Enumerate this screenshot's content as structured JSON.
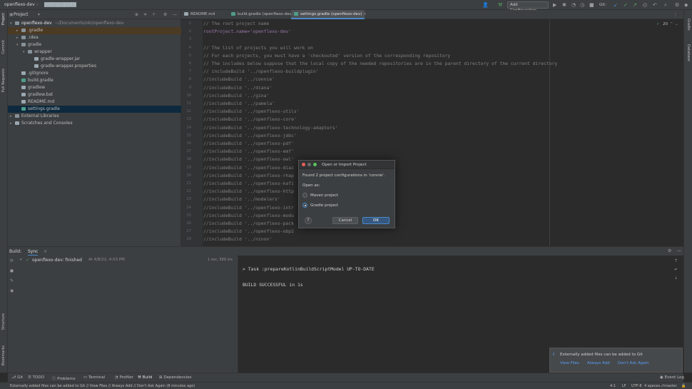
{
  "titlebar": {
    "project": "openflexo-dev",
    "file": "settings.gradle",
    "add_config": "Add Configuration...",
    "git_label": "Git:"
  },
  "left_strip": [
    "Project",
    "Commit",
    "Pull Requests",
    "Structure",
    "Bookmarks"
  ],
  "right_strip": [
    "Gradle",
    "Database"
  ],
  "project_panel": {
    "title": "Project",
    "tree": [
      {
        "indent": 0,
        "arrow": "▾",
        "icon": "folder",
        "label": "openflexo-dev",
        "extra": "~/Documents/oki/openflexo-dev",
        "state": ""
      },
      {
        "indent": 1,
        "arrow": "▸",
        "icon": "folder",
        "label": ".gradle",
        "extra": "",
        "state": "hl"
      },
      {
        "indent": 1,
        "arrow": "▸",
        "icon": "folder",
        "label": ".idea",
        "extra": "",
        "state": ""
      },
      {
        "indent": 1,
        "arrow": "▾",
        "icon": "folder",
        "label": "gradle",
        "extra": "",
        "state": ""
      },
      {
        "indent": 2,
        "arrow": "▾",
        "icon": "folder",
        "label": "wrapper",
        "extra": "",
        "state": ""
      },
      {
        "indent": 3,
        "arrow": "",
        "icon": "file",
        "label": "gradle-wrapper.jar",
        "extra": "",
        "state": ""
      },
      {
        "indent": 3,
        "arrow": "",
        "icon": "file",
        "label": "gradle-wrapper.properties",
        "extra": "",
        "state": ""
      },
      {
        "indent": 1,
        "arrow": "",
        "icon": "file",
        "label": ".gitignore",
        "extra": "",
        "state": ""
      },
      {
        "indent": 1,
        "arrow": "",
        "icon": "gradle",
        "label": "build.gradle",
        "extra": "",
        "state": ""
      },
      {
        "indent": 1,
        "arrow": "",
        "icon": "file",
        "label": "gradlew",
        "extra": "",
        "state": ""
      },
      {
        "indent": 1,
        "arrow": "",
        "icon": "file",
        "label": "gradlew.bat",
        "extra": "",
        "state": ""
      },
      {
        "indent": 1,
        "arrow": "",
        "icon": "file",
        "label": "README.md",
        "extra": "",
        "state": ""
      },
      {
        "indent": 1,
        "arrow": "",
        "icon": "gradle",
        "label": "settings.gradle",
        "extra": "",
        "state": "sel"
      },
      {
        "indent": 0,
        "arrow": "▸",
        "icon": "folder",
        "label": "External Libraries",
        "extra": "",
        "state": ""
      },
      {
        "indent": 0,
        "arrow": "▸",
        "icon": "file",
        "label": "Scratches and Consoles",
        "extra": "",
        "state": ""
      }
    ]
  },
  "tabs": [
    {
      "label": "README.md",
      "active": false
    },
    {
      "label": "build.gradle (openflexo-dev)",
      "active": false
    },
    {
      "label": "settings.gradle (openflexo-dev)",
      "active": true
    }
  ],
  "editor": {
    "warn_count": "20",
    "lines": [
      {
        "n": "1",
        "text": "// The root project name",
        "kind": "c"
      },
      {
        "n": "2",
        "text": "rootProject.name='openflexo-dev'",
        "kind": "kw"
      },
      {
        "n": "3",
        "text": "",
        "kind": "c"
      },
      {
        "n": "4",
        "text": "// The list of projects you will work on",
        "kind": "c"
      },
      {
        "n": "5",
        "text": "// For each projects, you must have a 'checkouted' version of the corresponding repository",
        "kind": "c"
      },
      {
        "n": "6",
        "text": "// The includes below suppose that the local copy of the needed repositories are in the parent directory of the current directory",
        "kind": "c"
      },
      {
        "n": "7",
        "text": "// includeBuild '../openflexo-buildplugin'",
        "kind": "c"
      },
      {
        "n": "8",
        "text": "//includeBuild '../connie'",
        "kind": "c"
      },
      {
        "n": "9",
        "text": "//includeBuild '../diana'",
        "kind": "c"
      },
      {
        "n": "10",
        "text": "//includeBuild '../gina'",
        "kind": "c"
      },
      {
        "n": "11",
        "text": "//includeBuild '../pamela'",
        "kind": "c"
      },
      {
        "n": "12",
        "text": "//includeBuild '../openflexo-utils'",
        "kind": "c"
      },
      {
        "n": "13",
        "text": "//includeBuild '../openflexo-core'",
        "kind": "c"
      },
      {
        "n": "14",
        "text": "//includeBuild '../openflexo-technology-adapters'",
        "kind": "c"
      },
      {
        "n": "15",
        "text": "//includeBuild '../openflexo-jdbc'",
        "kind": "c"
      },
      {
        "n": "16",
        "text": "//includeBuild '../openflexo-pdf'",
        "kind": "c"
      },
      {
        "n": "17",
        "text": "//includeBuild '../openflexo-emf'",
        "kind": "c"
      },
      {
        "n": "18",
        "text": "//includeBuild '../openflexo-owl'",
        "kind": "c"
      },
      {
        "n": "19",
        "text": "//includeBuild '../openflexo-diac",
        "kind": "c"
      },
      {
        "n": "20",
        "text": "//includeBuild '../openflexo-rhap",
        "kind": "c"
      },
      {
        "n": "21",
        "text": "//includeBuild '../openflexo-kafi",
        "kind": "c"
      },
      {
        "n": "22",
        "text": "//includeBuild '../openflexo-http",
        "kind": "c"
      },
      {
        "n": "23",
        "text": "//includeBuild '../modelers'",
        "kind": "c"
      },
      {
        "n": "24",
        "text": "//includeBuild '../openflexo-intr",
        "kind": "c"
      },
      {
        "n": "25",
        "text": "//includeBuild '../openflexo-modu",
        "kind": "c"
      },
      {
        "n": "26",
        "text": "//includeBuild '../openflexo-pack",
        "kind": "c"
      },
      {
        "n": "27",
        "text": "//includeBuild '../openflexo-obp2",
        "kind": "c"
      },
      {
        "n": "28",
        "text": "//includeBuild '../ninon'",
        "kind": "c"
      }
    ]
  },
  "dialog": {
    "title": "Open or Import Project",
    "message": "Found 2 project configurations in 'connie'.",
    "open_as": "Open as:",
    "options": [
      "Maven project",
      "Gradle project"
    ],
    "selected": "Gradle project",
    "cancel": "Cancel",
    "ok": "OK"
  },
  "build": {
    "label": "Build:",
    "tab": "Sync",
    "entry": "openflexo-dev: finished",
    "entry_time": "At 4/8/22, 4:03 PM",
    "duration": "1 sec, 589 ms",
    "output": [
      "> Task :prepareKotlinBuildScriptModel UP-TO-DATE",
      "",
      "BUILD SUCCESSFUL in 1s"
    ]
  },
  "notification": {
    "message": "Externally added files can be added to Git",
    "actions": [
      "View Files",
      "Always Add",
      "Don't Ask Again"
    ]
  },
  "bottom_tabs": [
    "Git",
    "TODO",
    "Problems",
    "Terminal",
    "Profiler",
    "Build",
    "Dependencies"
  ],
  "event_log": "Event Log",
  "status": {
    "message": "Externally added files can be added to Git // View Files // Always Add // Don't Ask Again (8 minutes ago)",
    "position": "4:1",
    "line_sep": "LF",
    "encoding": "UTF-8",
    "indent": "4 spaces",
    "branch": "master"
  }
}
